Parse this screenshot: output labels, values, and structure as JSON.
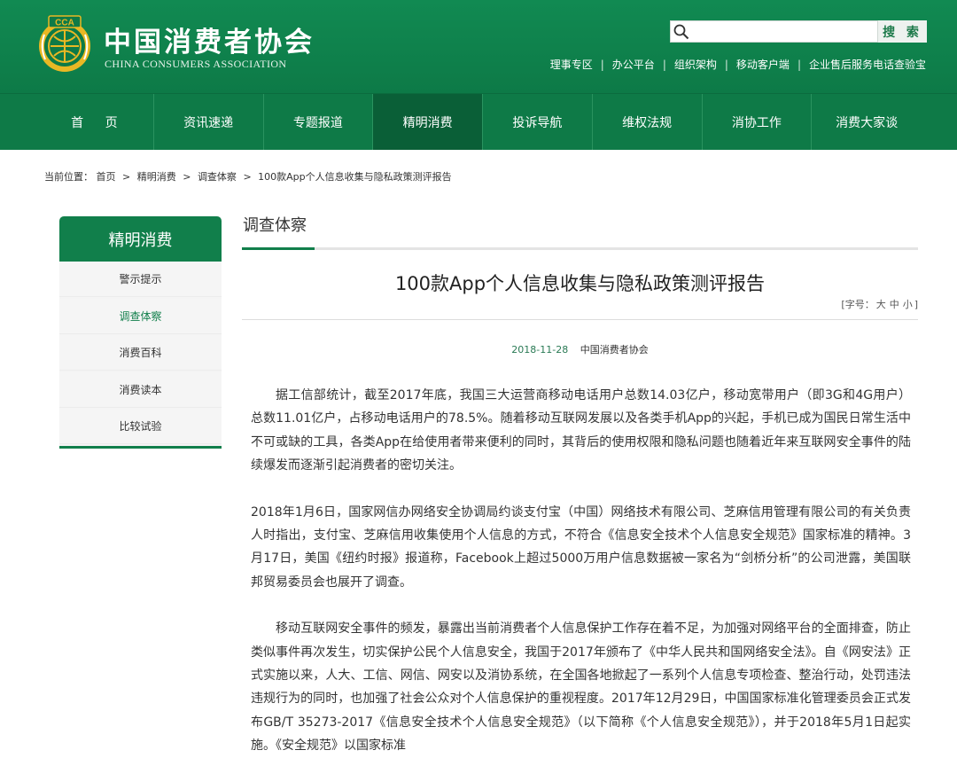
{
  "header": {
    "logo_cn": "中国消费者协会",
    "logo_en": "CHINA CONSUMERS ASSOCIATION",
    "logo_mark": "CCA",
    "search": {
      "placeholder": "",
      "value": "",
      "button_label": "搜 索"
    },
    "top_links": [
      "理事专区",
      "办公平台",
      "组织架构",
      "移动客户端",
      "企业售后服务电话查验宝"
    ],
    "colors": {
      "brand_green": "#0e7a47",
      "accent_gold": "#e9b824"
    }
  },
  "nav": {
    "items": [
      {
        "label": "首 页",
        "active": false
      },
      {
        "label": "资讯速递",
        "active": false
      },
      {
        "label": "专题报道",
        "active": false
      },
      {
        "label": "精明消费",
        "active": true
      },
      {
        "label": "投诉导航",
        "active": false
      },
      {
        "label": "维权法规",
        "active": false
      },
      {
        "label": "消协工作",
        "active": false
      },
      {
        "label": "消费大家谈",
        "active": false
      }
    ]
  },
  "breadcrumb": {
    "prefix": "当前位置：",
    "items": [
      "首页",
      "精明消费",
      "调查体察",
      "100款App个人信息收集与隐私政策测评报告"
    ],
    "separator": ">"
  },
  "sidebar": {
    "title": "精明消费",
    "items": [
      {
        "label": "警示提示",
        "active": false
      },
      {
        "label": "调查体察",
        "active": true
      },
      {
        "label": "消费百科",
        "active": false
      },
      {
        "label": "消费读本",
        "active": false
      },
      {
        "label": "比较试验",
        "active": false
      }
    ]
  },
  "main": {
    "section_title": "调查体察",
    "article_title": "100款App个人信息收集与隐私政策测评报告",
    "font_size": {
      "prefix": "[字号：",
      "large": "大",
      "medium": "中",
      "small": "小",
      "suffix": "]"
    },
    "date": "2018-11-28",
    "source": "中国消费者协会",
    "paragraphs": [
      "据工信部统计，截至2017年底，我国三大运营商移动电话用户总数14.03亿户，移动宽带用户（即3G和4G用户）总数11.01亿户，占移动电话用户的78.5%。随着移动互联网发展以及各类手机App的兴起，手机已成为国民日常生活中不可或缺的工具，各类App在给使用者带来便利的同时，其背后的使用权限和隐私问题也随着近年来互联网安全事件的陆续爆发而逐渐引起消费者的密切关注。",
      "2018年1月6日，国家网信办网络安全协调局约谈支付宝（中国）网络技术有限公司、芝麻信用管理有限公司的有关负责人时指出，支付宝、芝麻信用收集使用个人信息的方式，不符合《信息安全技术个人信息安全规范》国家标准的精神。3月17日，美国《纽约时报》报道称，Facebook上超过5000万用户信息数据被一家名为“剑桥分析”的公司泄露，美国联邦贸易委员会也展开了调查。",
      "移动互联网安全事件的频发，暴露出当前消费者个人信息保护工作存在着不足，为加强对网络平台的全面排查，防止类似事件再次发生，切实保护公民个人信息安全，我国于2017年颁布了《中华人民共和国网络安全法》。自《网安法》正式实施以来，人大、工信、网信、网安以及消协系统，在全国各地掀起了一系列个人信息专项检查、整治行动，处罚违法违规行为的同时，也加强了社会公众对个人信息保护的重视程度。2017年12月29日，中国国家标准化管理委员会正式发布GB/T 35273-2017《信息安全技术个人信息安全规范》（以下简称《个人信息安全规范》），并于2018年5月1日起实施。《安全规范》以国家标准"
    ]
  }
}
